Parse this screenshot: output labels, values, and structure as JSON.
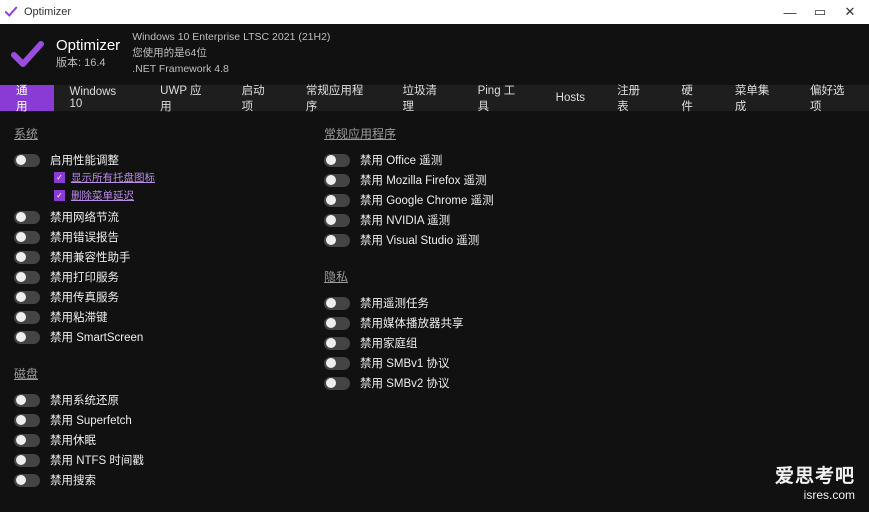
{
  "window": {
    "title": "Optimizer"
  },
  "header": {
    "app_name": "Optimizer",
    "version_prefix": "版本:",
    "version": "16.4",
    "os_line": "Windows 10 Enterprise LTSC 2021 (21H2)",
    "arch_line": "您使用的是64位",
    "framework_line": ".NET Framework 4.8"
  },
  "tabs": [
    "通用",
    "Windows 10",
    "UWP 应用",
    "启动项",
    "常规应用程序",
    "垃圾清理",
    "Ping 工具",
    "Hosts",
    "注册表",
    "硬件",
    "菜单集成",
    "偏好选项"
  ],
  "active_tab": 0,
  "sections": {
    "system": {
      "title": "系统",
      "items": [
        {
          "label": "启用性能调整",
          "sub": [
            "显示所有托盘图标",
            "删除菜单延迟"
          ]
        },
        {
          "label": "禁用网络节流"
        },
        {
          "label": "禁用错误报告"
        },
        {
          "label": "禁用兼容性助手"
        },
        {
          "label": "禁用打印服务"
        },
        {
          "label": "禁用传真服务"
        },
        {
          "label": "禁用粘滞键"
        },
        {
          "label": "禁用 SmartScreen"
        }
      ]
    },
    "disk": {
      "title": "磁盘",
      "items": [
        {
          "label": "禁用系统还原"
        },
        {
          "label": "禁用 Superfetch"
        },
        {
          "label": "禁用休眠"
        },
        {
          "label": "禁用 NTFS 时间戳"
        },
        {
          "label": "禁用搜索"
        }
      ]
    },
    "apps": {
      "title": "常规应用程序",
      "items": [
        {
          "label": "禁用 Office 遥测"
        },
        {
          "label": "禁用 Mozilla Firefox 遥测"
        },
        {
          "label": "禁用 Google Chrome 遥测"
        },
        {
          "label": "禁用 NVIDIA 遥测"
        },
        {
          "label": "禁用 Visual Studio 遥测"
        }
      ]
    },
    "privacy": {
      "title": "隐私",
      "items": [
        {
          "label": "禁用遥测任务"
        },
        {
          "label": "禁用媒体播放器共享"
        },
        {
          "label": "禁用家庭组"
        },
        {
          "label": "禁用 SMBv1 协议"
        },
        {
          "label": "禁用 SMBv2 协议"
        }
      ]
    }
  },
  "watermark": {
    "line1": "爱思考吧",
    "line2": "isres.com"
  },
  "colors": {
    "accent": "#8a3bd6"
  }
}
